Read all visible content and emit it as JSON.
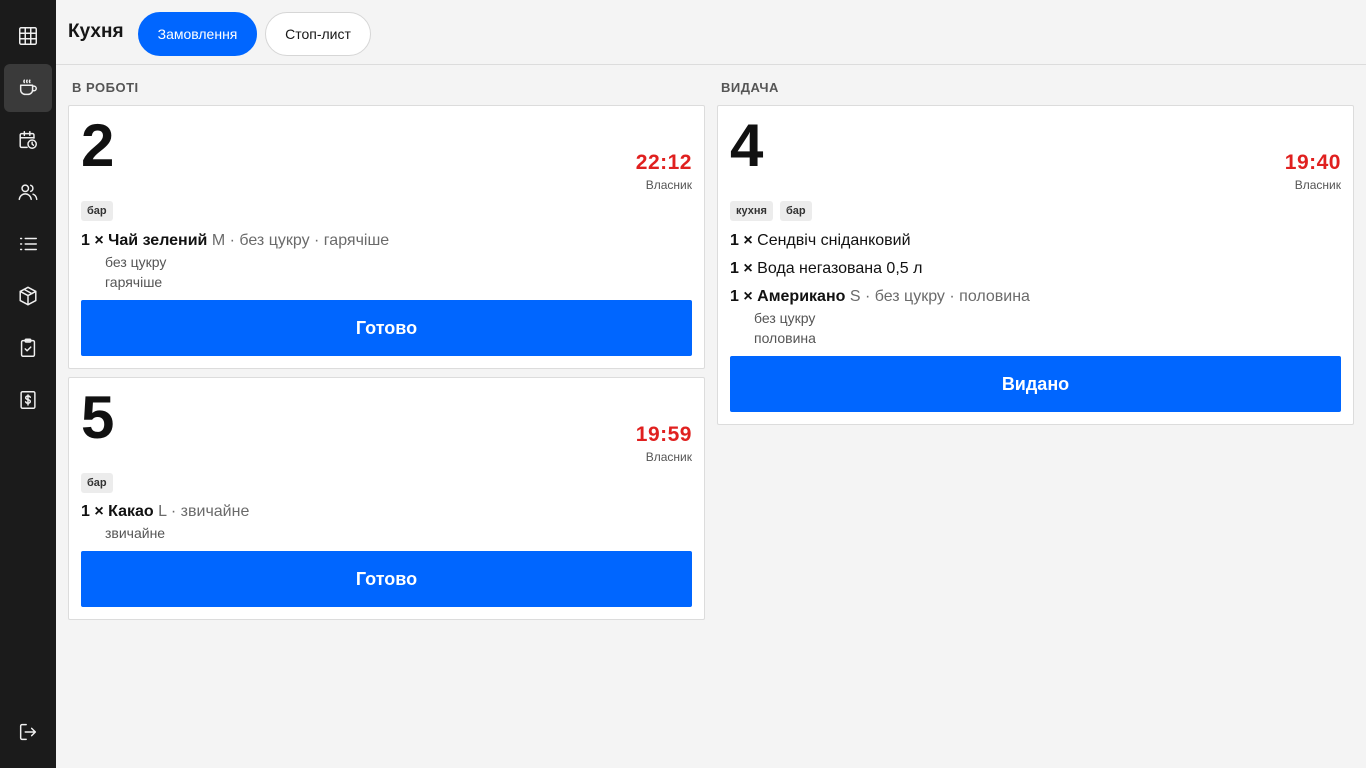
{
  "app": {
    "title": "Кухня"
  },
  "tabs": [
    {
      "label": "Замовлення",
      "active": true
    },
    {
      "label": "Стоп-лист",
      "active": false
    }
  ],
  "sidebar": {
    "items": [
      {
        "icon": "grid-icon",
        "active": false
      },
      {
        "icon": "coffee-cup-icon",
        "active": true
      },
      {
        "icon": "calendar-clock-icon",
        "active": false
      },
      {
        "icon": "users-icon",
        "active": false
      },
      {
        "icon": "list-icon",
        "active": false
      },
      {
        "icon": "box-icon",
        "active": false
      },
      {
        "icon": "clipboard-check-icon",
        "active": false
      },
      {
        "icon": "dollar-receipt-icon",
        "active": false
      }
    ],
    "logout_icon": "logout-icon"
  },
  "columns": {
    "in_work": {
      "title": "В РОБОТІ",
      "orders": [
        {
          "number": "2",
          "time": "22:12",
          "author": "Власник",
          "tags": [
            "бар"
          ],
          "items": [
            {
              "qty": "1 ×",
              "name": "Чай зелений",
              "opts": "M · без цукру · гарячіше",
              "mods": [
                "без цукру",
                "гарячіше"
              ]
            }
          ],
          "action": "Готово"
        },
        {
          "number": "5",
          "time": "19:59",
          "author": "Власник",
          "tags": [
            "бар"
          ],
          "items": [
            {
              "qty": "1 ×",
              "name": "Какао",
              "opts": "L · звичайне",
              "mods": [
                "звичайне"
              ]
            }
          ],
          "action": "Готово"
        }
      ]
    },
    "issue": {
      "title": "ВИДАЧА",
      "orders": [
        {
          "number": "4",
          "time": "19:40",
          "author": "Власник",
          "tags": [
            "кухня",
            "бар"
          ],
          "items": [
            {
              "qty": "1 ×",
              "name": "Сендвіч сніданковий",
              "opts": "",
              "mods": []
            },
            {
              "qty": "1 ×",
              "name": "Вода негазована 0,5 л",
              "opts": "",
              "mods": []
            },
            {
              "qty": "1 ×",
              "name": "Американо",
              "opts": "S · без цукру · половина",
              "mods": [
                "без цукру",
                "половина"
              ]
            }
          ],
          "action": "Видано"
        }
      ]
    }
  },
  "colors": {
    "accent": "#0066ff",
    "time": "#e0201f",
    "sidebar": "#1b1b1b"
  }
}
